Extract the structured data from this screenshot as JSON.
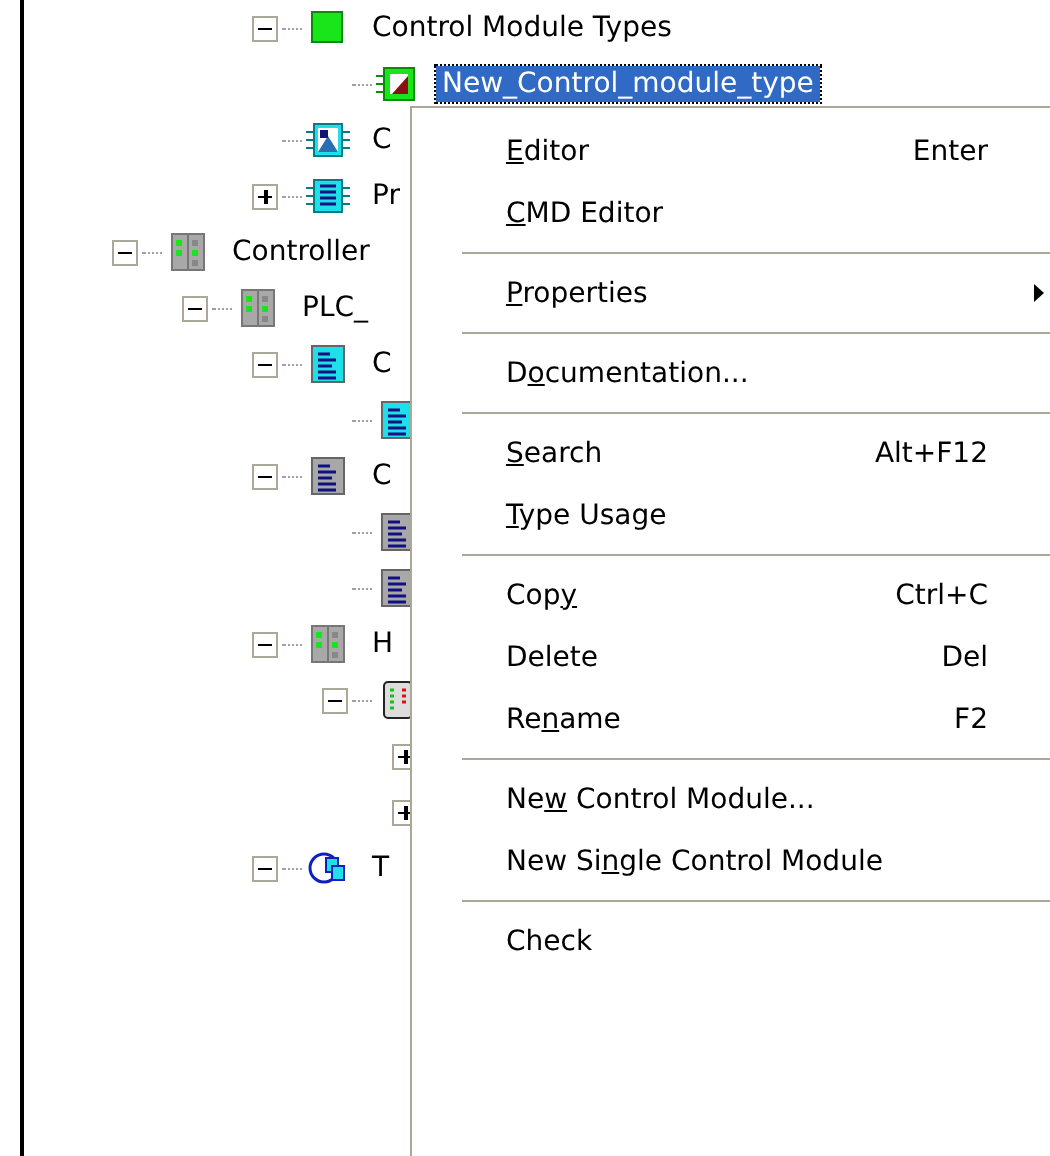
{
  "tree": {
    "clipped_branch": [
      {
        "kind": "module-type-folder",
        "label": "Control Module Types",
        "expanded": true,
        "selected": false,
        "children": [
          {
            "kind": "module-type",
            "label": "New_Control_module_type",
            "selected": true
          }
        ]
      },
      {
        "kind": "picture-module",
        "label": "C",
        "selected": false
      },
      {
        "kind": "program-module",
        "label": "Pr",
        "expanded": false,
        "selected": false
      }
    ],
    "items": [
      {
        "kind": "controller",
        "label": "Controller",
        "expanded": true,
        "selected": false,
        "children": [
          {
            "kind": "controller",
            "label": "PLC_",
            "expanded": true,
            "selected": false,
            "children": [
              {
                "kind": "document-cyan",
                "label": "C",
                "expanded": true,
                "selected": false,
                "children": [
                  {
                    "kind": "document-cyan"
                  }
                ]
              },
              {
                "kind": "document-gray",
                "label": "C",
                "expanded": true,
                "selected": false,
                "children": [
                  {
                    "kind": "document-gray"
                  },
                  {
                    "kind": "document-gray"
                  }
                ]
              },
              {
                "kind": "controller",
                "label": "H",
                "expanded": true,
                "selected": false,
                "children": [
                  {
                    "kind": "device",
                    "expanded": true,
                    "children": [
                      {
                        "expanded": false
                      },
                      {
                        "expanded": false
                      }
                    ]
                  }
                ]
              },
              {
                "kind": "tasks",
                "label": "T",
                "expanded": true,
                "selected": false
              }
            ]
          }
        ]
      }
    ]
  },
  "context_menu": {
    "items": [
      {
        "kind": "item",
        "label": {
          "key": "E",
          "after": "ditor"
        },
        "shortcut": "Enter"
      },
      {
        "kind": "item",
        "label": {
          "key": "C",
          "after": "MD Editor"
        }
      },
      {
        "kind": "separator"
      },
      {
        "kind": "submenu",
        "label": {
          "key": "P",
          "after": "roperties"
        }
      },
      {
        "kind": "separator"
      },
      {
        "kind": "item",
        "label": {
          "before": "D",
          "key": "o",
          "after": "cumentation..."
        }
      },
      {
        "kind": "separator"
      },
      {
        "kind": "item",
        "label": {
          "key": "S",
          "after": "earch"
        },
        "shortcut": "Alt+F12"
      },
      {
        "kind": "item",
        "label": {
          "key": "T",
          "after": "ype Usage"
        }
      },
      {
        "kind": "separator"
      },
      {
        "kind": "item",
        "label": {
          "before": "Cop",
          "key": "y"
        },
        "shortcut": "Ctrl+C"
      },
      {
        "kind": "item",
        "label": {
          "before": "Delete"
        },
        "shortcut": "Del"
      },
      {
        "kind": "item",
        "label": {
          "before": "Re",
          "key": "n",
          "after": "ame"
        },
        "shortcut": "F2"
      },
      {
        "kind": "separator"
      },
      {
        "kind": "item",
        "label": {
          "before": "Ne",
          "key": "w",
          "after": " Control Module..."
        }
      },
      {
        "kind": "item",
        "label": {
          "before": "New Si",
          "key": "n",
          "after": "gle Control Module"
        }
      },
      {
        "kind": "separator"
      },
      {
        "kind": "item",
        "label": {
          "before": "Check"
        }
      }
    ]
  }
}
